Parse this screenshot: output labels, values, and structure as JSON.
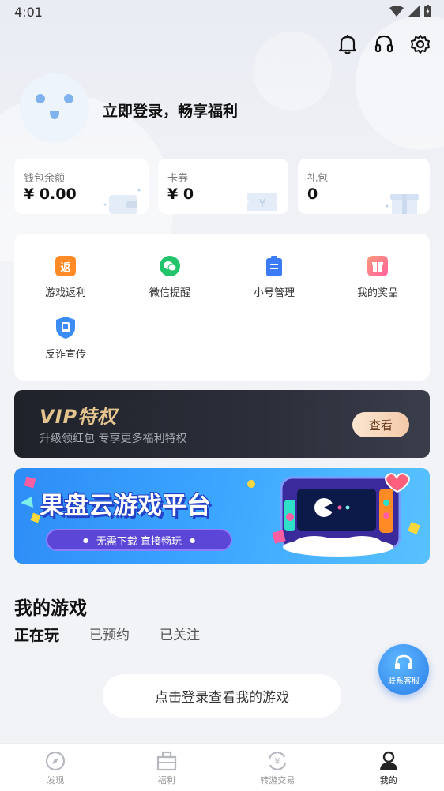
{
  "status_bar": {
    "time": "4:01"
  },
  "header": {
    "icons": [
      "bell-icon",
      "headset-icon",
      "gear-icon"
    ]
  },
  "profile": {
    "login_prompt": "立即登录，畅享福利"
  },
  "wallet": [
    {
      "label": "钱包余额",
      "value": "¥ 0.00"
    },
    {
      "label": "卡券",
      "value": "¥ 0"
    },
    {
      "label": "礼包",
      "value": "0"
    }
  ],
  "features": [
    {
      "label": "游戏返利",
      "icon": "rebate-icon",
      "icon_text": "返",
      "color": "#ff8a26"
    },
    {
      "label": "微信提醒",
      "icon": "wechat-icon",
      "color": "#21c46a"
    },
    {
      "label": "小号管理",
      "icon": "clipboard-icon",
      "color": "#3b7bf5"
    },
    {
      "label": "我的奖品",
      "icon": "gift-icon",
      "color": "#ff6c8a"
    },
    {
      "label": "反诈宣传",
      "icon": "shield-icon",
      "color": "#3b8cf5"
    }
  ],
  "vip": {
    "title": "VIP特权",
    "subtitle": "升级领红包 专享更多福利特权",
    "button": "查看"
  },
  "promo": {
    "title": "果盘云游戏平台",
    "pill_text": "无需下载  直接畅玩"
  },
  "my_games": {
    "title": "我的游戏",
    "tabs": [
      "正在玩",
      "已预约",
      "已关注"
    ],
    "active_tab": 0,
    "login_button": "点击登录查看我的游戏"
  },
  "float_support": {
    "label": "联系客服"
  },
  "bottom_nav": [
    {
      "label": "发现",
      "icon": "compass-icon"
    },
    {
      "label": "福利",
      "icon": "welfare-icon"
    },
    {
      "label": "转游交易",
      "icon": "exchange-icon"
    },
    {
      "label": "我的",
      "icon": "user-icon",
      "active": true
    }
  ],
  "colors": {
    "accent": "#3b7bf5",
    "vip_gold": "#e4c48e",
    "promo_blue": "#2e8df7"
  }
}
